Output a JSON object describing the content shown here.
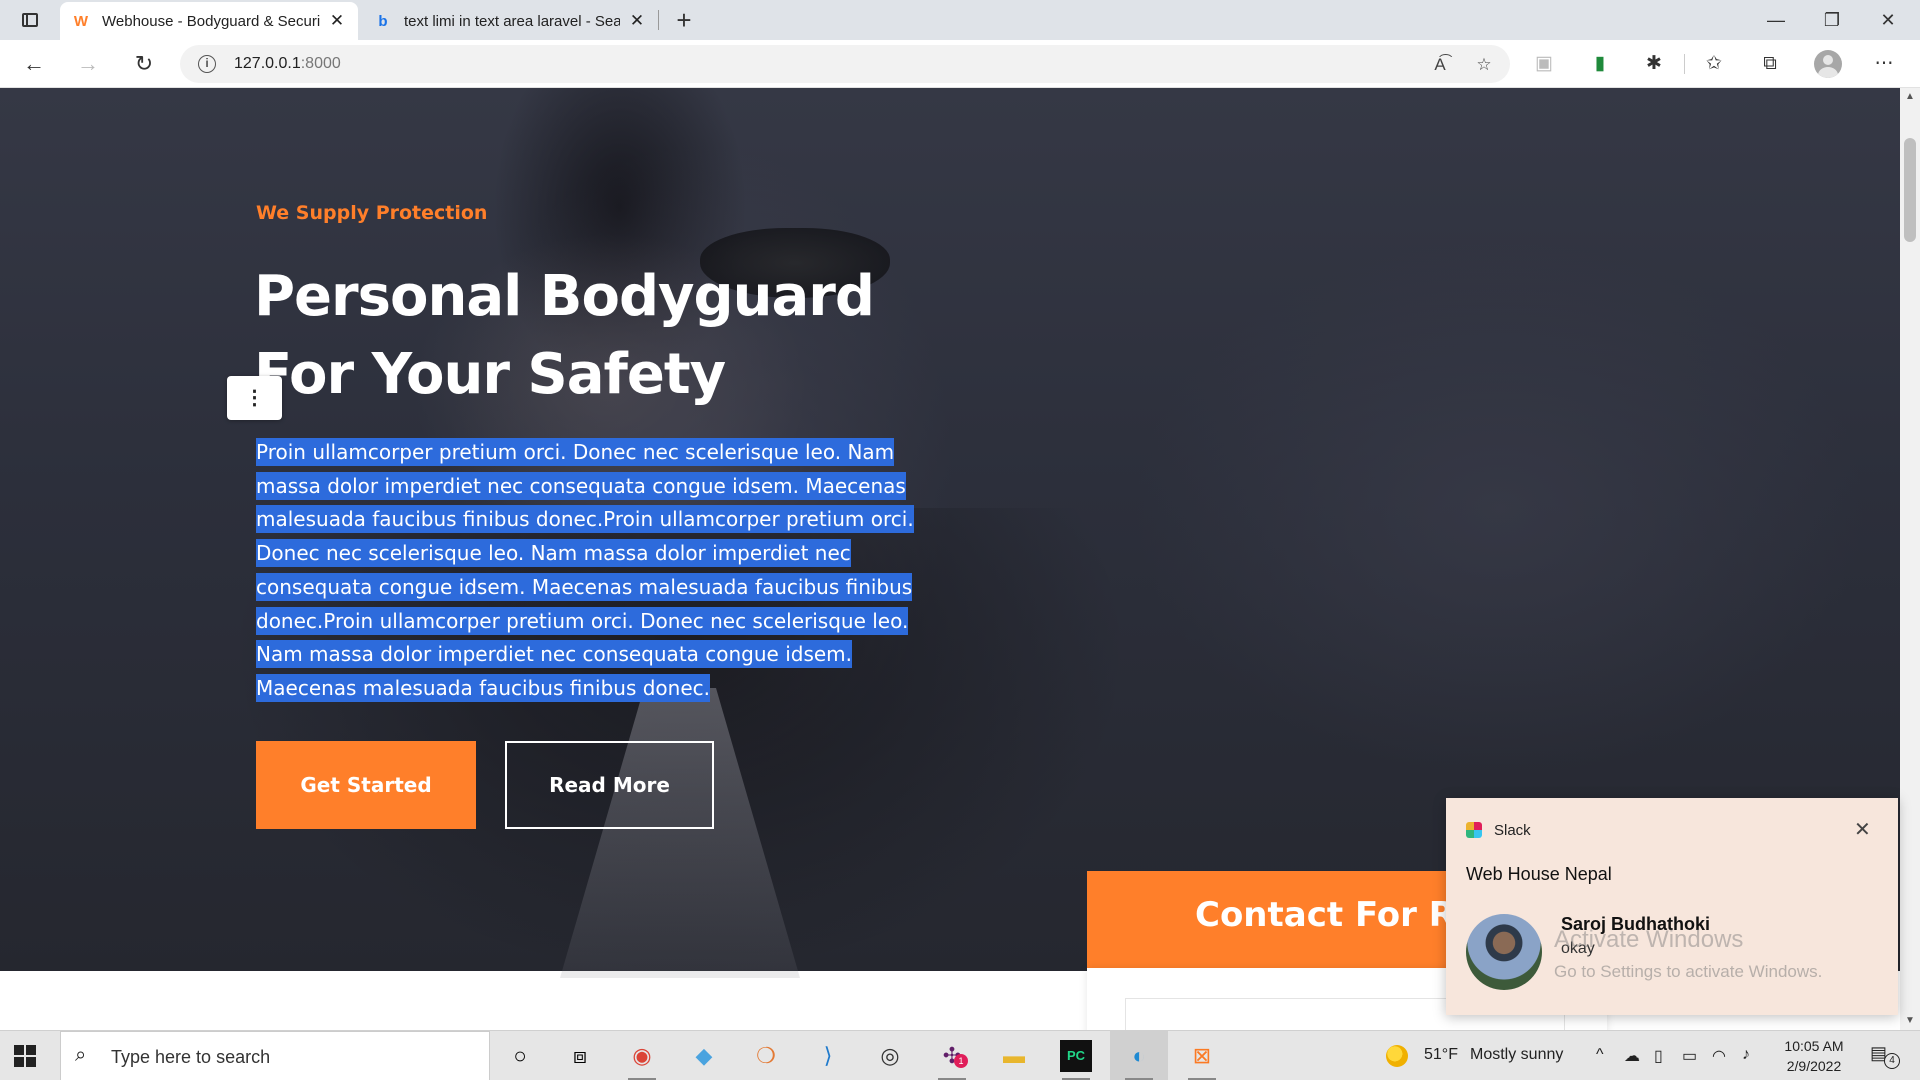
{
  "browser": {
    "tabs": [
      {
        "title": "Webhouse - Bodyguard & Securi",
        "favicon": "W",
        "active": true
      },
      {
        "title": "text limi in text area laravel - Sea",
        "favicon": "b",
        "active": false
      }
    ],
    "new_tab": "+",
    "url_host": "127.0.0.1",
    "url_port": ":8000",
    "window_controls": {
      "minimize": "—",
      "restore": "❐",
      "close": "✕"
    }
  },
  "hero": {
    "subtitle": "We Supply Protection",
    "headline_line1": "Personal Bodyguard",
    "headline_line2": "For Your Safety",
    "description": "Proin ullamcorper pretium orci. Donec nec scelerisque leo. Nam massa dolor imperdiet nec consequata congue idsem. Maecenas malesuada faucibus finibus donec.Proin ullamcorper pretium orci. Donec nec scelerisque leo. Nam massa dolor imperdiet nec consequata congue idsem. Maecenas malesuada faucibus finibus donec.Proin ullamcorper pretium orci. Donec nec scelerisque leo. Nam massa dolor imperdiet nec consequata congue idsem. Maecenas malesuada faucibus finibus donec.",
    "primary_button": "Get Started",
    "secondary_button": "Read More",
    "accent_color": "#ff7f2a",
    "selection_color": "#2d6bdc"
  },
  "contact": {
    "title": "Contact For Re"
  },
  "notification": {
    "app": "Slack",
    "workspace": "Web House Nepal",
    "sender": "Saroj Budhathoki",
    "message": "okay",
    "close": "✕"
  },
  "watermark": {
    "line1": "Activate Windows",
    "line2": "Go to Settings to activate Windows."
  },
  "taskbar": {
    "search_placeholder": "Type here to search",
    "weather_temp": "51°F",
    "weather_text": "Mostly sunny",
    "time": "10:05 AM",
    "date": "2/9/2022",
    "notification_count": "4",
    "slack_badge": "1"
  }
}
